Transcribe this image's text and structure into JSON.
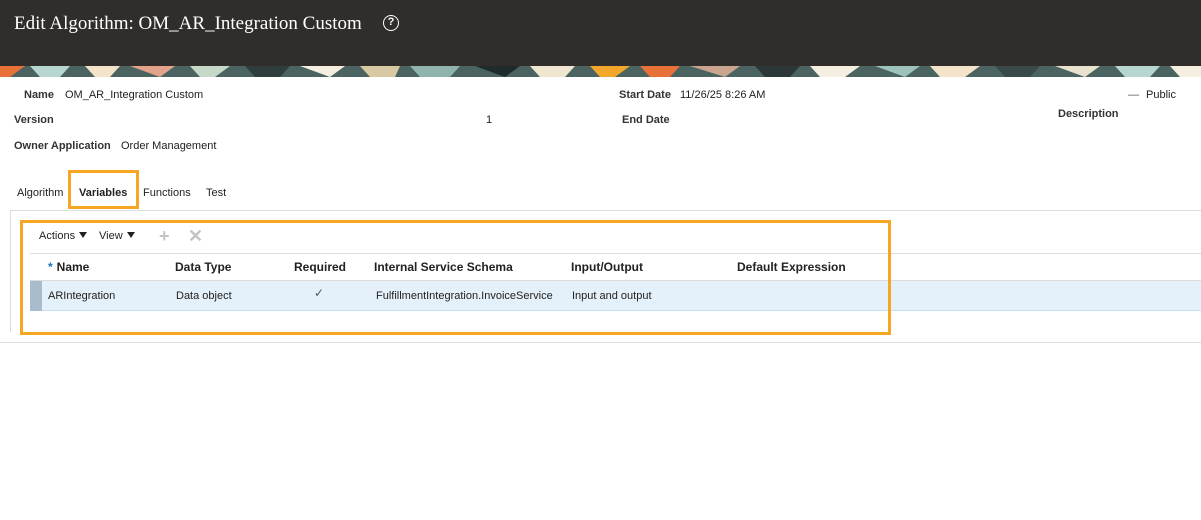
{
  "header": {
    "title": "Edit Algorithm: OM_AR_Integration Custom",
    "help_icon": "help-circle-icon"
  },
  "details": {
    "name_label": "Name",
    "name_value": "OM_AR_Integration Custom",
    "start_date_label": "Start Date",
    "start_date_value": "11/26/25 8:26 AM",
    "public_label": "Public",
    "version_label": "Version",
    "version_value": "1",
    "end_date_label": "End Date",
    "description_label": "Description",
    "owner_label": "Owner Application",
    "owner_value": "Order Management"
  },
  "tabs": [
    {
      "label": "Algorithm"
    },
    {
      "label": "Variables",
      "active": true
    },
    {
      "label": "Functions"
    },
    {
      "label": "Test"
    }
  ],
  "toolbar": {
    "actions_label": "Actions",
    "view_label": "View",
    "add_icon": "plus-icon",
    "delete_icon": "x-icon"
  },
  "grid": {
    "columns": [
      "Name",
      "Data Type",
      "Required",
      "Internal Service Schema",
      "Input/Output",
      "Default Expression"
    ],
    "rows": [
      {
        "name": "ARIntegration",
        "data_type": "Data object",
        "required": "✓",
        "schema": "FulfillmentIntegration.InvoiceService",
        "io": "Input and output",
        "default_expression": ""
      }
    ]
  },
  "colors": {
    "header_bg": "#312d2a",
    "highlight": "#f6a623",
    "selected_row": "#e4f0fa"
  }
}
